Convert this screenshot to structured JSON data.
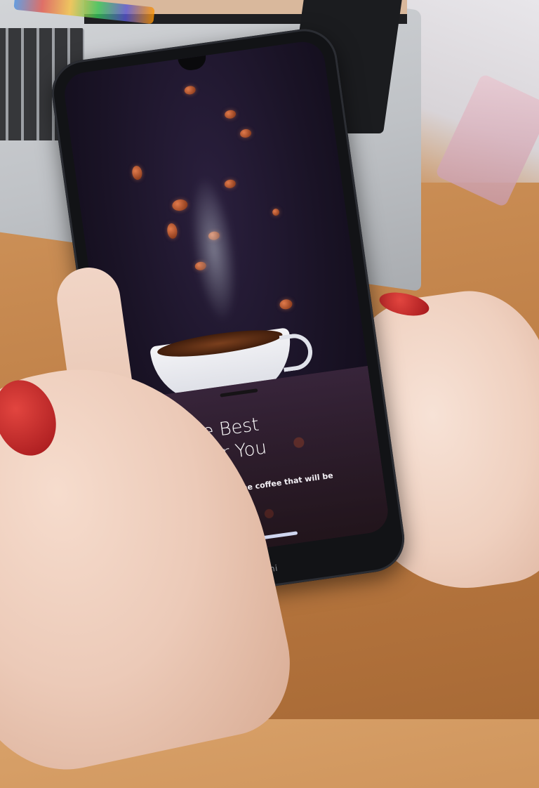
{
  "screen": {
    "title_line1": "Find The Best",
    "title_line2": "Coffee for You",
    "subtitle": "We will help you find the coffee that will be good for your soul."
  },
  "device": {
    "brand": "Redmi"
  },
  "colors": {
    "screen_background": "#1a1326",
    "nail_polish": "#c41e24",
    "gesture_bar": "#cfd6ef"
  }
}
